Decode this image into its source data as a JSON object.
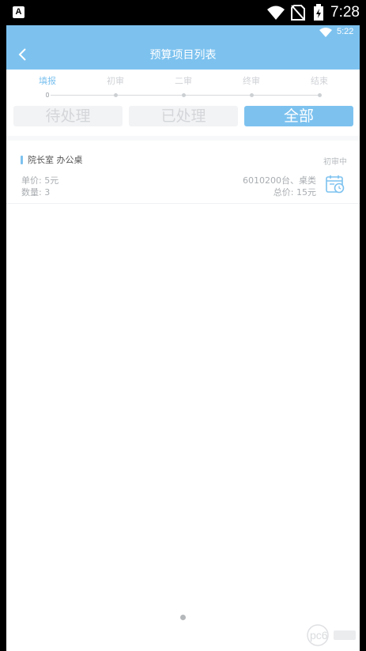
{
  "os_status": {
    "badge": "A",
    "time": "7:28",
    "icons": [
      "wifi-icon",
      "no-sim-icon",
      "battery-charging-icon"
    ]
  },
  "app_status": {
    "time": "5:22",
    "icons": [
      "wifi-icon"
    ]
  },
  "header": {
    "title": "预算项目列表",
    "back_icon": "chevron-left-icon"
  },
  "steps": [
    {
      "label": "填报",
      "active": true
    },
    {
      "label": "初审",
      "active": false
    },
    {
      "label": "二审",
      "active": false
    },
    {
      "label": "终审",
      "active": false
    },
    {
      "label": "结束",
      "active": false
    }
  ],
  "filter_tabs": [
    {
      "label": "待处理",
      "active": false
    },
    {
      "label": "已处理",
      "active": false
    },
    {
      "label": "全部",
      "active": true
    }
  ],
  "items": [
    {
      "title": "院长室 办公桌",
      "status": "初审中",
      "unit_price": "单价: 5元",
      "quantity": "数量: 3",
      "code": "6010200台、桌类",
      "total": "总价: 15元",
      "icon": "calendar-clock-icon"
    }
  ],
  "watermark": {
    "text": "pc6"
  },
  "colors": {
    "accent": "#7dc2ef",
    "inactive_text": "#cfd2d6",
    "secondary_text": "#a9adb1"
  }
}
